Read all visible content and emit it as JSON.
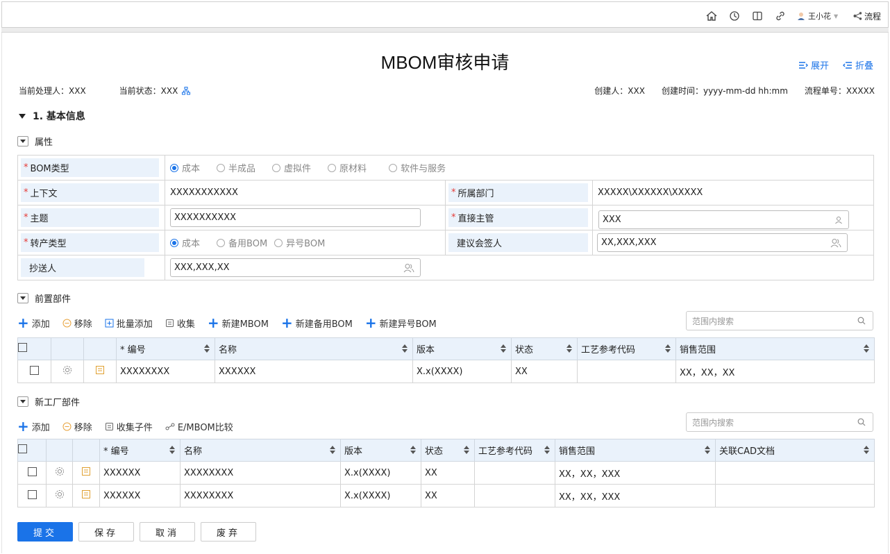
{
  "header": {
    "user_name": "王小花",
    "flow_label": "流程"
  },
  "page": {
    "title": "MBOM审核申请",
    "expand_label": "展开",
    "collapse_label": "折叠"
  },
  "meta": {
    "handler": "当前处理人：XXX",
    "status": "当前状态：XXX",
    "creator": "创建人：XXX",
    "created_time": "创建时间：yyyy-mm-dd hh:mm",
    "flow_no": "流程单号：XXXXX"
  },
  "section1": {
    "title": "1. 基本信息"
  },
  "attributes": {
    "title": "属性",
    "bom_type_label": "BOM类型",
    "bom_type_options": [
      "成本",
      "半成品",
      "虚拟件",
      "原材料",
      "软件与服务"
    ],
    "context_label": "上下文",
    "context_value": "XXXXXXXXXXX",
    "dept_label": "所属部门",
    "dept_value": "XXXXX\\XXXXXX\\XXXXX",
    "subject_label": "主题",
    "subject_value": "XXXXXXXXXX",
    "manager_label": "直接主管",
    "manager_value": "XXX",
    "transfer_label": "转产类型",
    "transfer_options": [
      "成本",
      "备用BOM",
      "异号BOM"
    ],
    "countersign_label": "建议会签人",
    "countersign_value": "XX,XXX,XXX",
    "cc_label": "抄送人",
    "cc_value": "XXX,XXX,XX"
  },
  "pre_parts": {
    "title": "前置部件",
    "toolbar": [
      "添加",
      "移除",
      "批量添加",
      "收集",
      "新建MBOM",
      "新建备用BOM",
      "新建异号BOM"
    ],
    "search_placeholder": "范围内搜索",
    "columns": [
      "* 编号",
      "名称",
      "版本",
      "状态",
      "工艺参考代码",
      "销售范围"
    ],
    "rows": [
      [
        "XXXXXXXX",
        "XXXXXX",
        "X.x(XXXX)",
        "XX",
        "",
        "XX，XX，XX"
      ]
    ]
  },
  "new_parts": {
    "title": "新工厂部件",
    "toolbar": [
      "添加",
      "移除",
      "收集子件",
      "E/MBOM比较"
    ],
    "search_placeholder": "范围内搜索",
    "columns": [
      "* 编号",
      "名称",
      "版本",
      "状态",
      "工艺参考代码",
      "销售范围",
      "关联CAD文档"
    ],
    "rows": [
      [
        "XXXXXX",
        "XXXXXXXX",
        "X.x(XXXX)",
        "XX",
        "",
        "XX，XX，XXX",
        ""
      ],
      [
        "XXXXXX",
        "XXXXXXXX",
        "X.x(XXXX)",
        "XX",
        "",
        "XX，XX，XXX",
        ""
      ]
    ]
  },
  "actions": {
    "submit": "提交",
    "save": "保存",
    "cancel": "取消",
    "discard": "废弃"
  },
  "colors": {
    "accent": "#1a73e8",
    "label_bg": "#eaf2fb",
    "required": "#e53935"
  }
}
